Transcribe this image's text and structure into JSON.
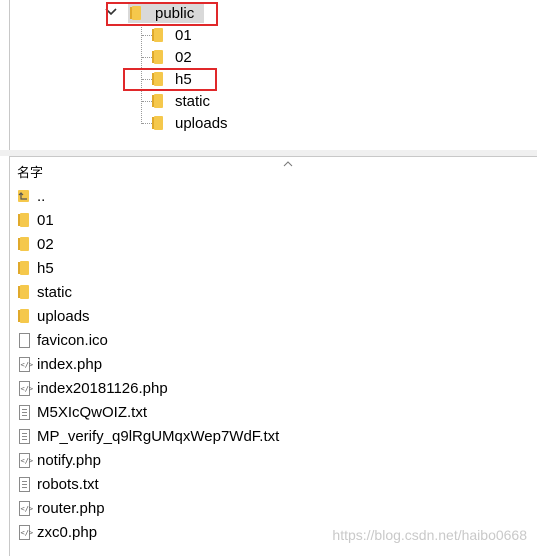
{
  "tree": {
    "root": "public",
    "children": [
      "01",
      "02",
      "h5",
      "static",
      "uploads"
    ]
  },
  "list": {
    "column_name": "名字",
    "up_label": "..",
    "folders": [
      "01",
      "02",
      "h5",
      "static",
      "uploads"
    ],
    "files": [
      {
        "name": "favicon.ico",
        "icon": "blank-file-icon"
      },
      {
        "name": "index.php",
        "icon": "php-file-icon"
      },
      {
        "name": "index20181126.php",
        "icon": "php-file-icon"
      },
      {
        "name": "M5XIcQwOIZ.txt",
        "icon": "text-file-icon"
      },
      {
        "name": "MP_verify_q9lRgUMqxWep7WdF.txt",
        "icon": "text-file-icon"
      },
      {
        "name": "notify.php",
        "icon": "php-file-icon"
      },
      {
        "name": "robots.txt",
        "icon": "text-file-icon"
      },
      {
        "name": "router.php",
        "icon": "php-file-icon"
      },
      {
        "name": "zxc0.php",
        "icon": "php-file-icon"
      }
    ]
  },
  "watermark": "https://blog.csdn.net/haibo0668",
  "colors": {
    "highlight_box": "#e0282a",
    "folder": "#f5c84c",
    "selection": "#d9d9d9"
  }
}
